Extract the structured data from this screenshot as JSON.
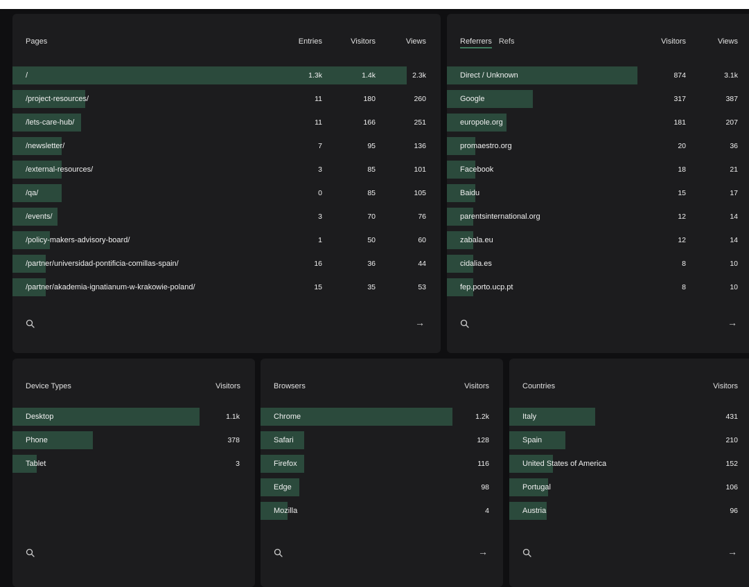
{
  "pages": {
    "title": "Pages",
    "columns": [
      "Entries",
      "Visitors",
      "Views"
    ],
    "rows": [
      {
        "label": "/",
        "entries": "1.3k",
        "visitors": "1.4k",
        "views": "2.3k",
        "share": 0.92
      },
      {
        "label": "/project-resources/",
        "entries": "11",
        "visitors": "180",
        "views": "260",
        "share": 0.17
      },
      {
        "label": "/lets-care-hub/",
        "entries": "11",
        "visitors": "166",
        "views": "251",
        "share": 0.16
      },
      {
        "label": "/newsletter/",
        "entries": "7",
        "visitors": "95",
        "views": "136",
        "share": 0.115
      },
      {
        "label": "/external-resources/",
        "entries": "3",
        "visitors": "85",
        "views": "101",
        "share": 0.115
      },
      {
        "label": "/qa/",
        "entries": "0",
        "visitors": "85",
        "views": "105",
        "share": 0.115
      },
      {
        "label": "/events/",
        "entries": "3",
        "visitors": "70",
        "views": "76",
        "share": 0.105
      },
      {
        "label": "/policy-makers-advisory-board/",
        "entries": "1",
        "visitors": "50",
        "views": "60",
        "share": 0.088
      },
      {
        "label": "/partner/universidad-pontificia-comillas-spain/",
        "entries": "16",
        "visitors": "36",
        "views": "44",
        "share": 0.077
      },
      {
        "label": "/partner/akademia-ignatianum-w-krakowie-poland/",
        "entries": "15",
        "visitors": "35",
        "views": "53",
        "share": 0.077
      }
    ],
    "more_arrow": "→"
  },
  "referrers": {
    "title": "Referrers",
    "tab_refs": "Refs",
    "columns": [
      "Visitors",
      "Views"
    ],
    "rows": [
      {
        "label": "Direct / Unknown",
        "visitors": "874",
        "views": "3.1k",
        "share": 0.61
      },
      {
        "label": "Google",
        "visitors": "317",
        "views": "387",
        "share": 0.275
      },
      {
        "label": "europole.org",
        "visitors": "181",
        "views": "207",
        "share": 0.19
      },
      {
        "label": "promaestro.org",
        "visitors": "20",
        "views": "36",
        "share": 0.09
      },
      {
        "label": "Facebook",
        "visitors": "18",
        "views": "21",
        "share": 0.09
      },
      {
        "label": "Baidu",
        "visitors": "15",
        "views": "17",
        "share": 0.09
      },
      {
        "label": "parentsinternational.org",
        "visitors": "12",
        "views": "14",
        "share": 0.085
      },
      {
        "label": "zabala.eu",
        "visitors": "12",
        "views": "14",
        "share": 0.085
      },
      {
        "label": "cidalia.es",
        "visitors": "8",
        "views": "10",
        "share": 0.085
      },
      {
        "label": "fep.porto.ucp.pt",
        "visitors": "8",
        "views": "10",
        "share": 0.085
      }
    ],
    "more_arrow": "→"
  },
  "devices": {
    "title": "Device Types",
    "column": "Visitors",
    "rows": [
      {
        "label": "Desktop",
        "visitors": "1.1k",
        "share": 0.77
      },
      {
        "label": "Phone",
        "visitors": "378",
        "share": 0.33
      },
      {
        "label": "Tablet",
        "visitors": "3",
        "share": 0.1
      }
    ]
  },
  "browsers": {
    "title": "Browsers",
    "column": "Visitors",
    "rows": [
      {
        "label": "Chrome",
        "visitors": "1.2k",
        "share": 0.79
      },
      {
        "label": "Safari",
        "visitors": "128",
        "share": 0.18
      },
      {
        "label": "Firefox",
        "visitors": "116",
        "share": 0.18
      },
      {
        "label": "Edge",
        "visitors": "98",
        "share": 0.16
      },
      {
        "label": "Mozilla",
        "visitors": "4",
        "share": 0.11
      }
    ],
    "more_arrow": "→"
  },
  "countries": {
    "title": "Countries",
    "column": "Visitors",
    "rows": [
      {
        "label": "Italy",
        "visitors": "431",
        "share": 0.345
      },
      {
        "label": "Spain",
        "visitors": "210",
        "share": 0.225
      },
      {
        "label": "United States of America",
        "visitors": "152",
        "share": 0.175
      },
      {
        "label": "Portugal",
        "visitors": "106",
        "share": 0.155
      },
      {
        "label": "Austria",
        "visitors": "96",
        "share": 0.15
      }
    ],
    "more_arrow": "→"
  },
  "colors": {
    "background": "#0f0f11",
    "panel": "#1c1c1e",
    "bar": "#2b4a3c",
    "accent": "#3e7a5c"
  }
}
